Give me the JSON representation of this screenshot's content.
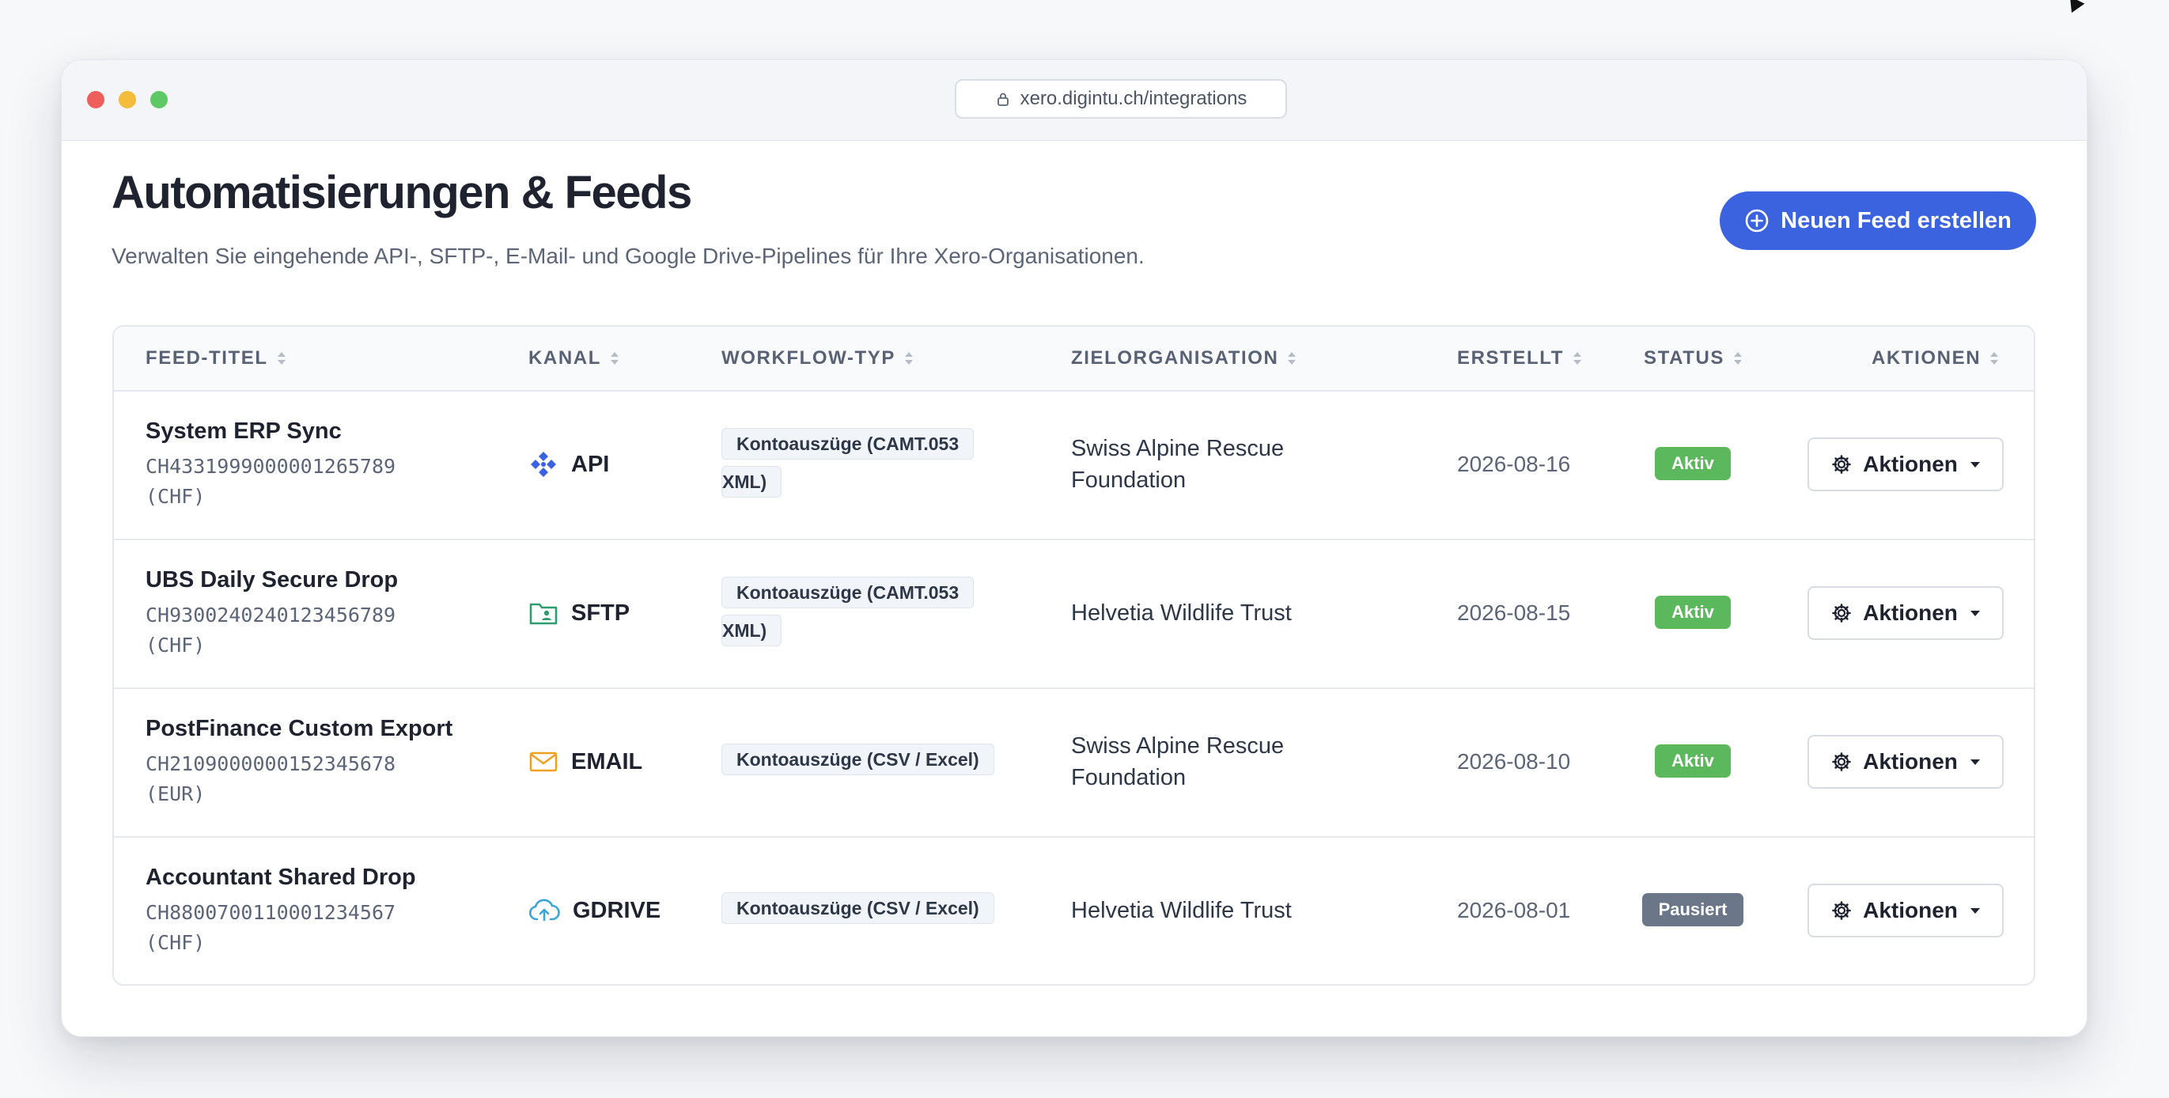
{
  "browser": {
    "url": "xero.digintu.ch/integrations"
  },
  "page": {
    "title": "Automatisierungen & Feeds",
    "subtitle": "Verwalten Sie eingehende API-, SFTP-, E-Mail- und Google Drive-Pipelines für Ihre Xero-Organisationen.",
    "primary_button": "Neuen Feed erstellen"
  },
  "table": {
    "columns": [
      "FEED-TITEL",
      "KANAL",
      "WORKFLOW-TYP",
      "ZIELORGANISATION",
      "ERSTELLT",
      "STATUS",
      "AKTIONEN"
    ],
    "rows": [
      {
        "title": "System ERP Sync",
        "iban": "CH4331999000001265789",
        "currency": "(CHF)",
        "channel": "API",
        "channel_icon": "api-network-icon",
        "workflow_line1": "Kontoauszüge (CAMT.053",
        "workflow_line2": "XML)",
        "org_line1": "Swiss Alpine Rescue",
        "org_line2": "Foundation",
        "created": "2026-08-16",
        "status": "Aktiv",
        "action": "Aktionen"
      },
      {
        "title": "UBS Daily Secure Drop",
        "iban": "CH9300240240123456789",
        "currency": "(CHF)",
        "channel": "SFTP",
        "channel_icon": "folder-user-icon",
        "workflow_line1": "Kontoauszüge (CAMT.053",
        "workflow_line2": "XML)",
        "org_line1": "Helvetia Wildlife Trust",
        "org_line2": "",
        "created": "2026-08-15",
        "status": "Aktiv",
        "action": "Aktionen"
      },
      {
        "title": "PostFinance Custom Export",
        "iban": "CH2109000000152345678",
        "currency": "(EUR)",
        "channel": "EMAIL",
        "channel_icon": "envelope-icon",
        "workflow_line1": "Kontoauszüge (CSV / Excel)",
        "workflow_line2": "",
        "org_line1": "Swiss Alpine Rescue",
        "org_line2": "Foundation",
        "created": "2026-08-10",
        "status": "Aktiv",
        "action": "Aktionen"
      },
      {
        "title": "Accountant Shared Drop",
        "iban": "CH8800700110001234567",
        "currency": "(CHF)",
        "channel": "GDRIVE",
        "channel_icon": "cloud-upload-icon",
        "workflow_line1": "Kontoauszüge (CSV / Excel)",
        "workflow_line2": "",
        "org_line1": "Helvetia Wildlife Trust",
        "org_line2": "",
        "created": "2026-08-01",
        "status": "Pausiert",
        "action": "Aktionen"
      }
    ]
  },
  "colors": {
    "primary": "#3b63e0",
    "status_active": "#5cb85c",
    "status_paused": "#6b7689",
    "api_icon": "#3b63e0",
    "sftp_icon": "#2f9e6e",
    "email_icon": "#f0a020",
    "gdrive_icon": "#3aa6d8"
  }
}
